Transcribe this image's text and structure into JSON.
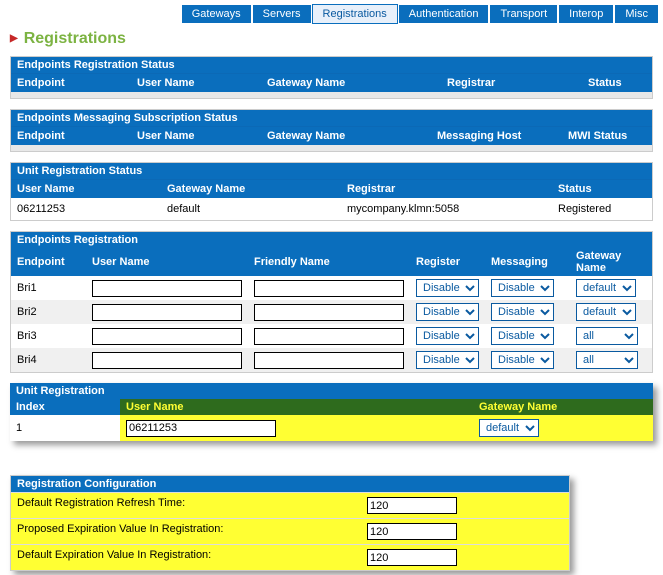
{
  "tabs": {
    "items": [
      "Gateways",
      "Servers",
      "Registrations",
      "Authentication",
      "Transport",
      "Interop",
      "Misc"
    ],
    "active": "Registrations"
  },
  "page_title": "Registrations",
  "sections": {
    "endpoints_reg_status": {
      "title": "Endpoints Registration Status",
      "cols": [
        "Endpoint",
        "User Name",
        "Gateway Name",
        "Registrar",
        "Status"
      ]
    },
    "endpoints_msg_sub_status": {
      "title": "Endpoints Messaging Subscription Status",
      "cols": [
        "Endpoint",
        "User Name",
        "Gateway Name",
        "Messaging Host",
        "MWI Status"
      ]
    },
    "unit_reg_status": {
      "title": "Unit Registration Status",
      "cols": [
        "User Name",
        "Gateway Name",
        "Registrar",
        "Status"
      ],
      "rows": [
        {
          "user": "06211253",
          "gateway": "default",
          "registrar": "mycompany.klmn:5058",
          "status": "Registered"
        }
      ]
    },
    "endpoints_reg": {
      "title": "Endpoints Registration",
      "cols": [
        "Endpoint",
        "User Name",
        "Friendly Name",
        "Register",
        "Messaging",
        "Gateway Name"
      ],
      "rows": [
        {
          "ep": "Bri1",
          "user": "",
          "friendly": "",
          "register": "Disable",
          "messaging": "Disable",
          "gw": "default"
        },
        {
          "ep": "Bri2",
          "user": "",
          "friendly": "",
          "register": "Disable",
          "messaging": "Disable",
          "gw": "default"
        },
        {
          "ep": "Bri3",
          "user": "",
          "friendly": "",
          "register": "Disable",
          "messaging": "Disable",
          "gw": "all"
        },
        {
          "ep": "Bri4",
          "user": "",
          "friendly": "",
          "register": "Disable",
          "messaging": "Disable",
          "gw": "all"
        }
      ]
    },
    "unit_reg": {
      "title": "Unit Registration",
      "cols": [
        "Index",
        "User Name",
        "Gateway Name"
      ],
      "rows": [
        {
          "index": "1",
          "user": "06211253",
          "gw": "default"
        }
      ]
    },
    "reg_config": {
      "title": "Registration Configuration",
      "rows": [
        {
          "label": "Default Registration Refresh Time:",
          "value": "120"
        },
        {
          "label": "Proposed Expiration Value In Registration:",
          "value": "120"
        },
        {
          "label": "Default Expiration Value In Registration:",
          "value": "120"
        }
      ]
    }
  }
}
